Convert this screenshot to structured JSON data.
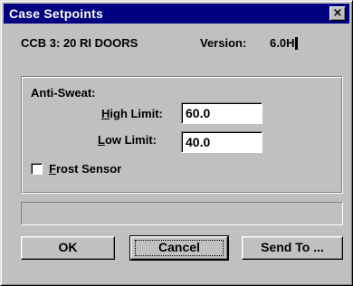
{
  "window": {
    "title": "Case Setpoints",
    "close_glyph": "×"
  },
  "header": {
    "device": "CCB 3: 20 RI DOORS",
    "version_label": "Version:",
    "version_value": "6.0H"
  },
  "anti_sweat": {
    "group_label": "Anti-Sweat:",
    "high_limit": {
      "label_mnemonic": "H",
      "label_rest": "igh Limit:",
      "value": "60.0"
    },
    "low_limit": {
      "label_mnemonic": "L",
      "label_rest": "ow Limit:",
      "value": "40.0"
    },
    "frost_sensor": {
      "label_mnemonic": "F",
      "label_rest": "rost Sensor",
      "checked": false
    }
  },
  "status": {
    "text": ""
  },
  "buttons": {
    "ok": "OK",
    "cancel": "Cancel",
    "send_to": "Send To ..."
  },
  "colors": {
    "titlebar": "#000080",
    "face": "#c0c0c0",
    "input_bg": "#ffffff"
  }
}
